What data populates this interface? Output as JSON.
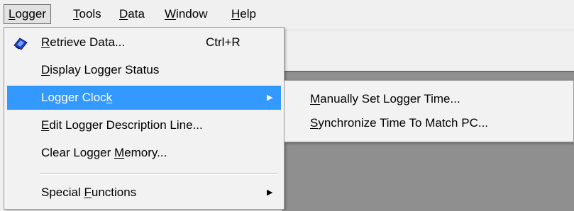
{
  "menubar": {
    "items": [
      {
        "label": "Logger",
        "underline": "L",
        "rest": "ogger"
      },
      {
        "label": "Tools",
        "underline": "T",
        "rest": "ools"
      },
      {
        "label": "Data",
        "underline": "D",
        "rest": "ata"
      },
      {
        "label": "Window",
        "underline": "W",
        "rest": "indow"
      },
      {
        "label": "Help",
        "underline": "H",
        "rest": "elp"
      }
    ]
  },
  "logger_menu": {
    "items": [
      {
        "pre": "",
        "underline": "R",
        "post": "etrieve Data...",
        "shortcut": "Ctrl+R",
        "icon": "retrieve-data-icon"
      },
      {
        "pre": "",
        "underline": "D",
        "post": "isplay Logger Status"
      },
      {
        "pre": "Logger Cloc",
        "underline": "k",
        "post": "",
        "submenu": true
      },
      {
        "pre": "",
        "underline": "E",
        "post": "dit Logger Description Line..."
      },
      {
        "pre": "Clear Logger ",
        "underline": "M",
        "post": "emory..."
      },
      {
        "pre": "Special ",
        "underline": "F",
        "post": "unctions",
        "submenu": true
      }
    ]
  },
  "clock_submenu": {
    "items": [
      {
        "pre": "",
        "underline": "M",
        "post": "anually Set Logger Time..."
      },
      {
        "pre": "",
        "underline": "S",
        "post": "ynchronize Time To Match PC..."
      }
    ]
  },
  "colors": {
    "highlight": "#3399ff",
    "workspace": "#8f8f8f",
    "menu_bg": "#f2f2f2"
  }
}
